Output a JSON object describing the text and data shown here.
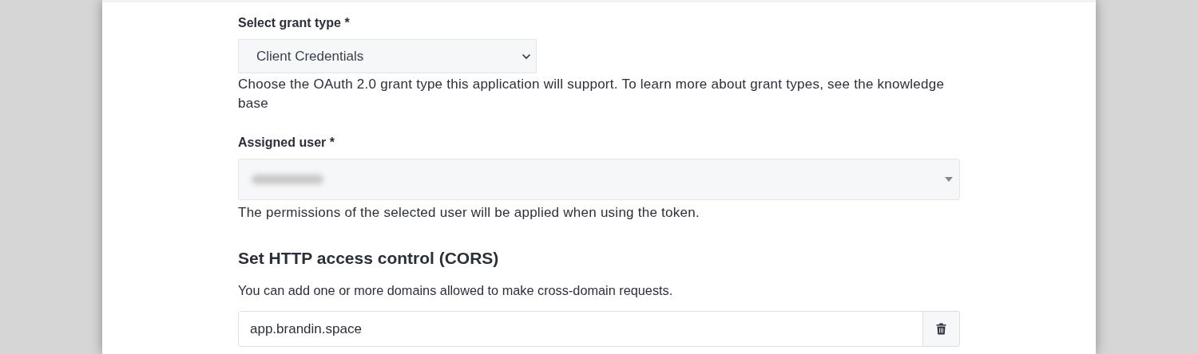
{
  "grant_type": {
    "label": "Select grant type *",
    "value": "Client Credentials",
    "help": "Choose the OAuth 2.0 grant type this application will support. To learn more about grant types, see the knowledge base"
  },
  "assigned_user": {
    "label": "Assigned user *",
    "help": "The permissions of the selected user will be applied when using the token."
  },
  "cors": {
    "heading": "Set HTTP access control (CORS)",
    "description": "You can add one or more domains allowed to make cross-domain requests.",
    "domains": [
      {
        "value": "app.brandin.space"
      }
    ]
  }
}
